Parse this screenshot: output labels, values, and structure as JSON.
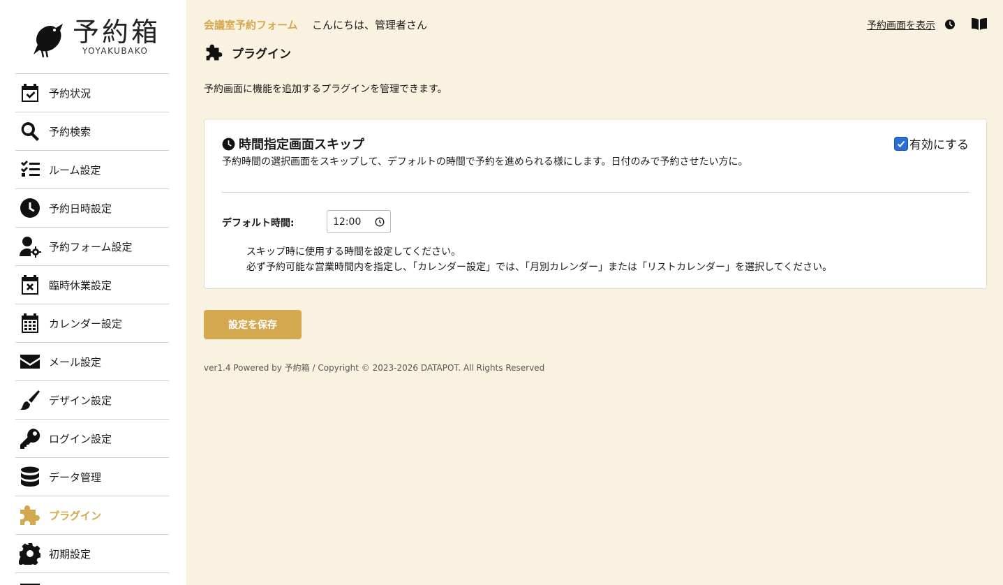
{
  "logo": {
    "title": "予約箱",
    "subtitle": "YOYAKUBAKO"
  },
  "sidebar": {
    "items": [
      {
        "label": "予約状況",
        "icon": "calendar-check-icon"
      },
      {
        "label": "予約検索",
        "icon": "search-icon"
      },
      {
        "label": "ルーム設定",
        "icon": "list-check-icon"
      },
      {
        "label": "予約日時設定",
        "icon": "clock-icon"
      },
      {
        "label": "予約フォーム設定",
        "icon": "user-gear-icon"
      },
      {
        "label": "臨時休業設定",
        "icon": "calendar-xmark-icon"
      },
      {
        "label": "カレンダー設定",
        "icon": "calendar-days-icon"
      },
      {
        "label": "メール設定",
        "icon": "envelope-icon"
      },
      {
        "label": "デザイン設定",
        "icon": "paintbrush-icon"
      },
      {
        "label": "ログイン設定",
        "icon": "key-icon"
      },
      {
        "label": "データ管理",
        "icon": "database-icon"
      },
      {
        "label": "プラグイン",
        "icon": "puzzle-icon",
        "active": true
      },
      {
        "label": "初期設定",
        "icon": "gear-icon"
      }
    ]
  },
  "header": {
    "brand": "会議室予約フォーム",
    "greeting": "こんにちは、管理者さん",
    "view_link": "予約画面を表示"
  },
  "page": {
    "title": "プラグイン",
    "description": "予約画面に機能を追加するプラグインを管理できます。"
  },
  "plugin": {
    "title": "時間指定画面スキップ",
    "description": "予約時間の選択画面をスキップして、デフォルトの時間で予約を進められる様にします。日付のみで予約させたい方に。",
    "enable_label": "有効にする",
    "enabled": true,
    "field_label": "デフォルト時間:",
    "time_value": "12:00",
    "help_line1": "スキップ時に使用する時間を設定してください。",
    "help_line2": "必ず予約可能な営業時間内を指定し、「カレンダー設定」では、「月別カレンダー」または「リストカレンダー」を選択してください。"
  },
  "actions": {
    "save_label": "設定を保存"
  },
  "footer": {
    "text": "ver1.4 Powered by 予約箱 / Copyright © 2023-2026 DATAPOT. All Rights Reserved"
  },
  "colors": {
    "accent": "#d4a84f",
    "background": "#faf2e1",
    "checkbox": "#2a6fd6"
  }
}
